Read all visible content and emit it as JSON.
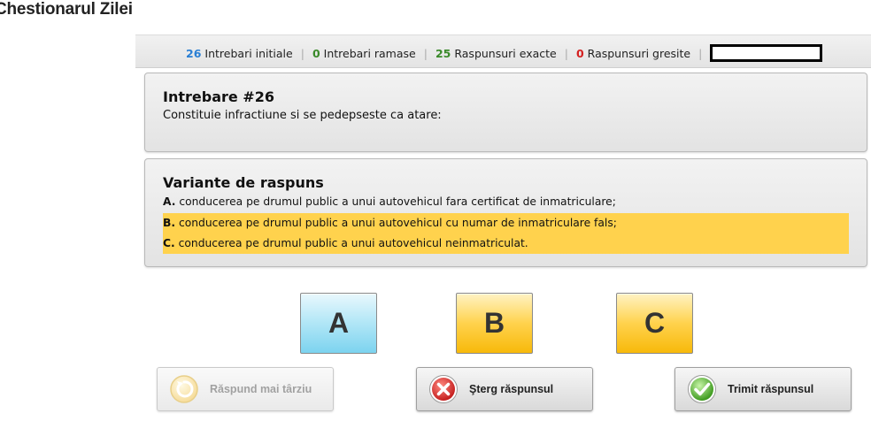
{
  "page": {
    "title": "Chestionarul Zilei"
  },
  "stats": {
    "initial": {
      "count": "26",
      "label": "Intrebari initiale",
      "color": "#2a7fd4"
    },
    "remaining": {
      "count": "0",
      "label": "Intrebari ramase",
      "color": "#3a8a2a"
    },
    "correct": {
      "count": "25",
      "label": "Raspunsuri exacte",
      "color": "#3a8a2a"
    },
    "wrong": {
      "count": "0",
      "label": "Raspunsuri gresite",
      "color": "#d42020"
    },
    "separator": "|"
  },
  "question": {
    "heading": "Intrebare #26",
    "text": "Constituie infractiune si se pedepseste ca atare:"
  },
  "answers": {
    "heading": "Variante de raspuns",
    "options": [
      {
        "letter": "A.",
        "text": " conducerea pe drumul public a unui autovehicul fara certificat de inmatriculare;",
        "highlighted": false
      },
      {
        "letter": "B.",
        "text": " conducerea pe drumul public a unui autovehicul cu numar de inmatriculare fals;",
        "highlighted": true
      },
      {
        "letter": "C.",
        "text": " conducerea pe drumul public a unui autovehicul neinmatriculat.",
        "highlighted": true
      }
    ],
    "highlight_color": "#ffd24d"
  },
  "choice_buttons": [
    {
      "label": "A",
      "state": "unselected"
    },
    {
      "label": "B",
      "state": "selected"
    },
    {
      "label": "C",
      "state": "selected"
    }
  ],
  "actions": {
    "later": {
      "label": "Răspund mai târziu",
      "icon": "clock-refresh-icon",
      "disabled": true
    },
    "clear": {
      "label": "Şterg răspunsul",
      "icon": "red-x-icon"
    },
    "submit": {
      "label": "Trimit răspunsul",
      "icon": "green-check-icon"
    }
  }
}
